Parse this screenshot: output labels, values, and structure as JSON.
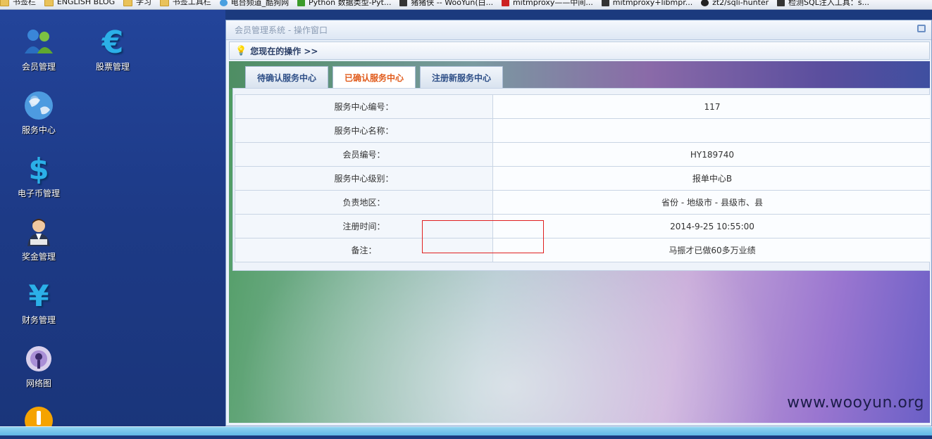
{
  "bookmarks": [
    {
      "label": "书签栏",
      "icon": "folder-icon",
      "iconClass": "folder"
    },
    {
      "label": "ENGLISH BLOG",
      "icon": "folder-icon",
      "iconClass": "folder"
    },
    {
      "label": "学习",
      "icon": "folder-icon",
      "iconClass": "folder"
    },
    {
      "label": "书签工具栏",
      "icon": "folder-icon",
      "iconClass": "folder"
    },
    {
      "label": "电台频道_酷狗网",
      "icon": "globe-icon",
      "iconClass": "globe"
    },
    {
      "label": "Python 数据类型-Pyt...",
      "icon": "site-icon",
      "iconClass": "green"
    },
    {
      "label": "猪猪侠 -- WooYun(白...",
      "icon": "site-icon",
      "iconClass": "dark"
    },
    {
      "label": "mitmproxy——中间...",
      "icon": "site-icon",
      "iconClass": "redw"
    },
    {
      "label": "mitmproxy+libmpr...",
      "icon": "site-icon",
      "iconClass": "dark"
    },
    {
      "label": "zt2/sqli-hunter",
      "icon": "github-icon",
      "iconClass": "gh"
    },
    {
      "label": "检测SQL注入工具：s...",
      "icon": "site-icon",
      "iconClass": "dark"
    }
  ],
  "desktop": {
    "icons": [
      {
        "label": "会员管理",
        "icon": "users-icon"
      },
      {
        "label": "股票管理",
        "icon": "euro-icon"
      },
      {
        "label": "服务中心",
        "icon": "globe-icon"
      },
      {
        "label": "电子币管理",
        "icon": "dollar-icon"
      },
      {
        "label": "奖金管理",
        "icon": "person-icon"
      },
      {
        "label": "财务管理",
        "icon": "yen-icon"
      },
      {
        "label": "网络图",
        "icon": "network-icon"
      },
      {
        "label": "",
        "icon": "warning-icon"
      }
    ]
  },
  "window": {
    "title": "会员管理系统 - 操作窗口",
    "operation_label": "您现在的操作 >>",
    "tabs": [
      {
        "label": "待确认服务中心",
        "active": false
      },
      {
        "label": "已确认服务中心",
        "active": true
      },
      {
        "label": "注册新服务中心",
        "active": false
      }
    ],
    "rows": [
      {
        "key": "服务中心编号：",
        "value": "117"
      },
      {
        "key": "服务中心名称：",
        "value": ""
      },
      {
        "key": "会员编号：",
        "value": "HY189740"
      },
      {
        "key": "服务中心级别：",
        "value": "报单中心B"
      },
      {
        "key": "负责地区：",
        "value": "省份 - 地级市 - 县级市、县"
      },
      {
        "key": "注册时间：",
        "value": "2014-9-25 10:55:00"
      },
      {
        "key": "备注：",
        "value": "马振才已做60多万业绩"
      }
    ]
  },
  "watermark": "www.wooyun.org",
  "colors": {
    "active_tab": "#e05a1a",
    "tab_text": "#2e4f87",
    "highlight_box": "#e02020",
    "desktop_bg": "#1d3a86"
  }
}
